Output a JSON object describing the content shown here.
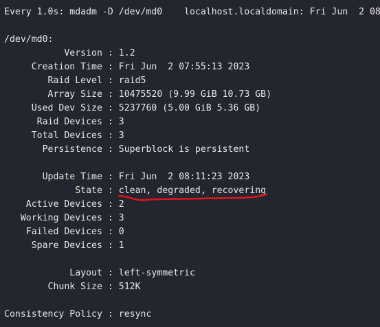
{
  "header": {
    "command": "Every 1.0s: mdadm -D /dev/md0",
    "host_time": "localhost.localdomain: Fri Jun  2 08"
  },
  "device_heading": "/dev/md0:",
  "separator": " : ",
  "fields": [
    {
      "label": "           Version",
      "value": "1.2"
    },
    {
      "label": "     Creation Time",
      "value": "Fri Jun  2 07:55:13 2023"
    },
    {
      "label": "        Raid Level",
      "value": "raid5"
    },
    {
      "label": "        Array Size",
      "value": "10475520 (9.99 GiB 10.73 GB)"
    },
    {
      "label": "     Used Dev Size",
      "value": "5237760 (5.00 GiB 5.36 GB)"
    },
    {
      "label": "      Raid Devices",
      "value": "3"
    },
    {
      "label": "     Total Devices",
      "value": "3"
    },
    {
      "label": "       Persistence",
      "value": "Superblock is persistent"
    },
    {
      "label": "       Update Time",
      "value": "Fri Jun  2 08:11:23 2023"
    },
    {
      "label": "             State",
      "value": "clean, degraded, recovering"
    },
    {
      "label": "    Active Devices",
      "value": "2"
    },
    {
      "label": "   Working Devices",
      "value": "3"
    },
    {
      "label": "    Failed Devices",
      "value": "0"
    },
    {
      "label": "     Spare Devices",
      "value": "1"
    },
    {
      "label": "            Layout",
      "value": "left-symmetric"
    },
    {
      "label": "        Chunk Size",
      "value": "512K"
    },
    {
      "label": "Consistency Policy",
      "value": "resync"
    }
  ],
  "colors": {
    "background": "#23262e",
    "text": "#e6e7ea",
    "annotation": "#e0141c"
  }
}
